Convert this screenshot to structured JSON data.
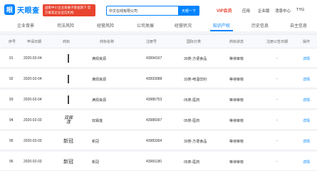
{
  "header": {
    "logo_mark": "眼",
    "logo_text": "天眼查",
    "gov_badge": "国家中小企业发展子基金旗下 官方备案企业征信机构",
    "search_value": "中文在线有限公司",
    "search_button": "天眼一下",
    "nav": {
      "vip": "VIP会员",
      "app": "应用",
      "enterprise": "企业版",
      "notice": "专业版",
      "shortcuts": "消息中心",
      "user": "TYG"
    }
  },
  "tabs": [
    {
      "label": "企业背景",
      "count": "",
      "active": false
    },
    {
      "label": "司法风险",
      "count": "",
      "active": false
    },
    {
      "label": "经营风险",
      "count": "",
      "active": false
    },
    {
      "label": "公司发展",
      "count": "",
      "active": false
    },
    {
      "label": "经营状况",
      "count": "",
      "active": false
    },
    {
      "label": "知识产权",
      "count": "",
      "active": true
    },
    {
      "label": "历史信息",
      "count": "",
      "active": false
    },
    {
      "label": "自主信息",
      "count": "",
      "active": false
    }
  ],
  "table": {
    "columns": [
      "序号",
      "申请日期",
      "商标",
      "商标名称",
      "注册号",
      "国际分类",
      "商标状态",
      "注册公告日期",
      "操作"
    ],
    "rows": [
      {
        "no": "91",
        "date": "2020-02-04",
        "thumb": "bar",
        "name": "满现良源",
        "reg": "43994167",
        "class": "30类-方便食品",
        "status": "等待审核",
        "notice": "-",
        "action": "详情"
      },
      {
        "no": "92",
        "date": "2020-02-04",
        "thumb": "bar",
        "name": "满现良源",
        "reg": "43993088",
        "class": "33类-啤酒饮料",
        "status": "等待审核",
        "notice": "-",
        "action": "详情"
      },
      {
        "no": "93",
        "date": "2020-02-04",
        "thumb": "bar",
        "name": "满现良源",
        "reg": "43986753",
        "class": "05类-医药",
        "status": "等待审核",
        "notice": "-",
        "action": "详情"
      },
      {
        "no": "94",
        "date": "2020-02-03",
        "thumb": "script",
        "script_text": "双霖\n莲",
        "name": "双霖莲",
        "reg": "43988397",
        "class": "05类-医药",
        "status": "等待审核",
        "notice": "-",
        "action": "详情"
      },
      {
        "no": "95",
        "date": "2020-02-03",
        "thumb": "glyph",
        "glyph_text": "新冠",
        "name": "新冠",
        "reg": "43983364",
        "class": "30类-方便食品",
        "status": "等待审核",
        "notice": "-",
        "action": "详情"
      },
      {
        "no": "96",
        "date": "2020-02-03",
        "thumb": "glyph",
        "glyph_text": "新冠",
        "name": "新冠",
        "reg": "43981180",
        "class": "05类-医药",
        "status": "等待审核",
        "notice": "-",
        "action": "详情"
      }
    ]
  },
  "colors": {
    "accent": "#0084ff",
    "danger": "#e8442f"
  }
}
